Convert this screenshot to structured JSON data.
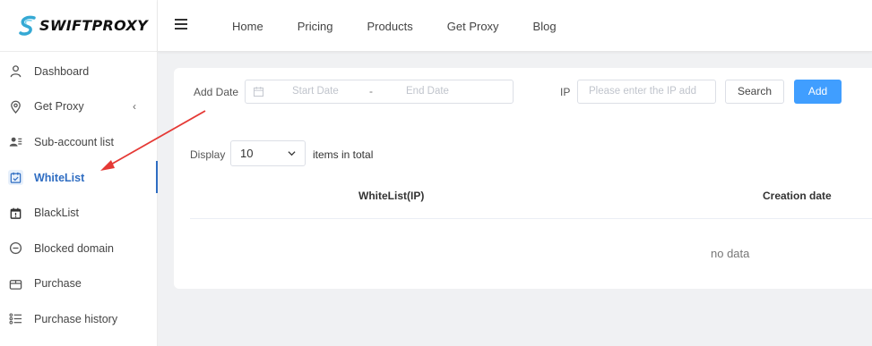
{
  "brand": {
    "name": "SWIFTPROXY",
    "accent": "#2f6dc2"
  },
  "sidebar": {
    "items": [
      {
        "label": "Dashboard",
        "icon": "user-icon",
        "active": false
      },
      {
        "label": "Get Proxy",
        "icon": "location-pin-icon",
        "active": false,
        "chevron": "‹"
      },
      {
        "label": "Sub-account list",
        "icon": "contacts-icon",
        "active": false
      },
      {
        "label": "WhiteList",
        "icon": "calendar-check-icon",
        "active": true
      },
      {
        "label": "BlackList",
        "icon": "calendar-alert-icon",
        "active": false
      },
      {
        "label": "Blocked domain",
        "icon": "minus-circle-icon",
        "active": false
      },
      {
        "label": "Purchase",
        "icon": "bag-icon",
        "active": false
      },
      {
        "label": "Purchase history",
        "icon": "list-icon",
        "active": false
      }
    ]
  },
  "topnav": {
    "menu_icon": "hamburger-icon",
    "links": [
      "Home",
      "Pricing",
      "Products",
      "Get Proxy",
      "Blog"
    ]
  },
  "filters": {
    "add_date_label": "Add Date",
    "start_placeholder": "Start Date",
    "range_separator": "-",
    "end_placeholder": "End Date",
    "ip_label": "IP",
    "ip_placeholder": "Please enter the IP add",
    "search_label": "Search",
    "add_label": "Add",
    "add_color": "#409eff"
  },
  "pagination": {
    "display_label": "Display",
    "page_size": "10",
    "items_total_label": "items in total"
  },
  "table": {
    "columns": [
      "WhiteList(IP)",
      "Creation date"
    ],
    "empty_text": "no data"
  },
  "annotation": {
    "arrow_color": "#e53935",
    "icon": "red-arrow-annotation"
  }
}
